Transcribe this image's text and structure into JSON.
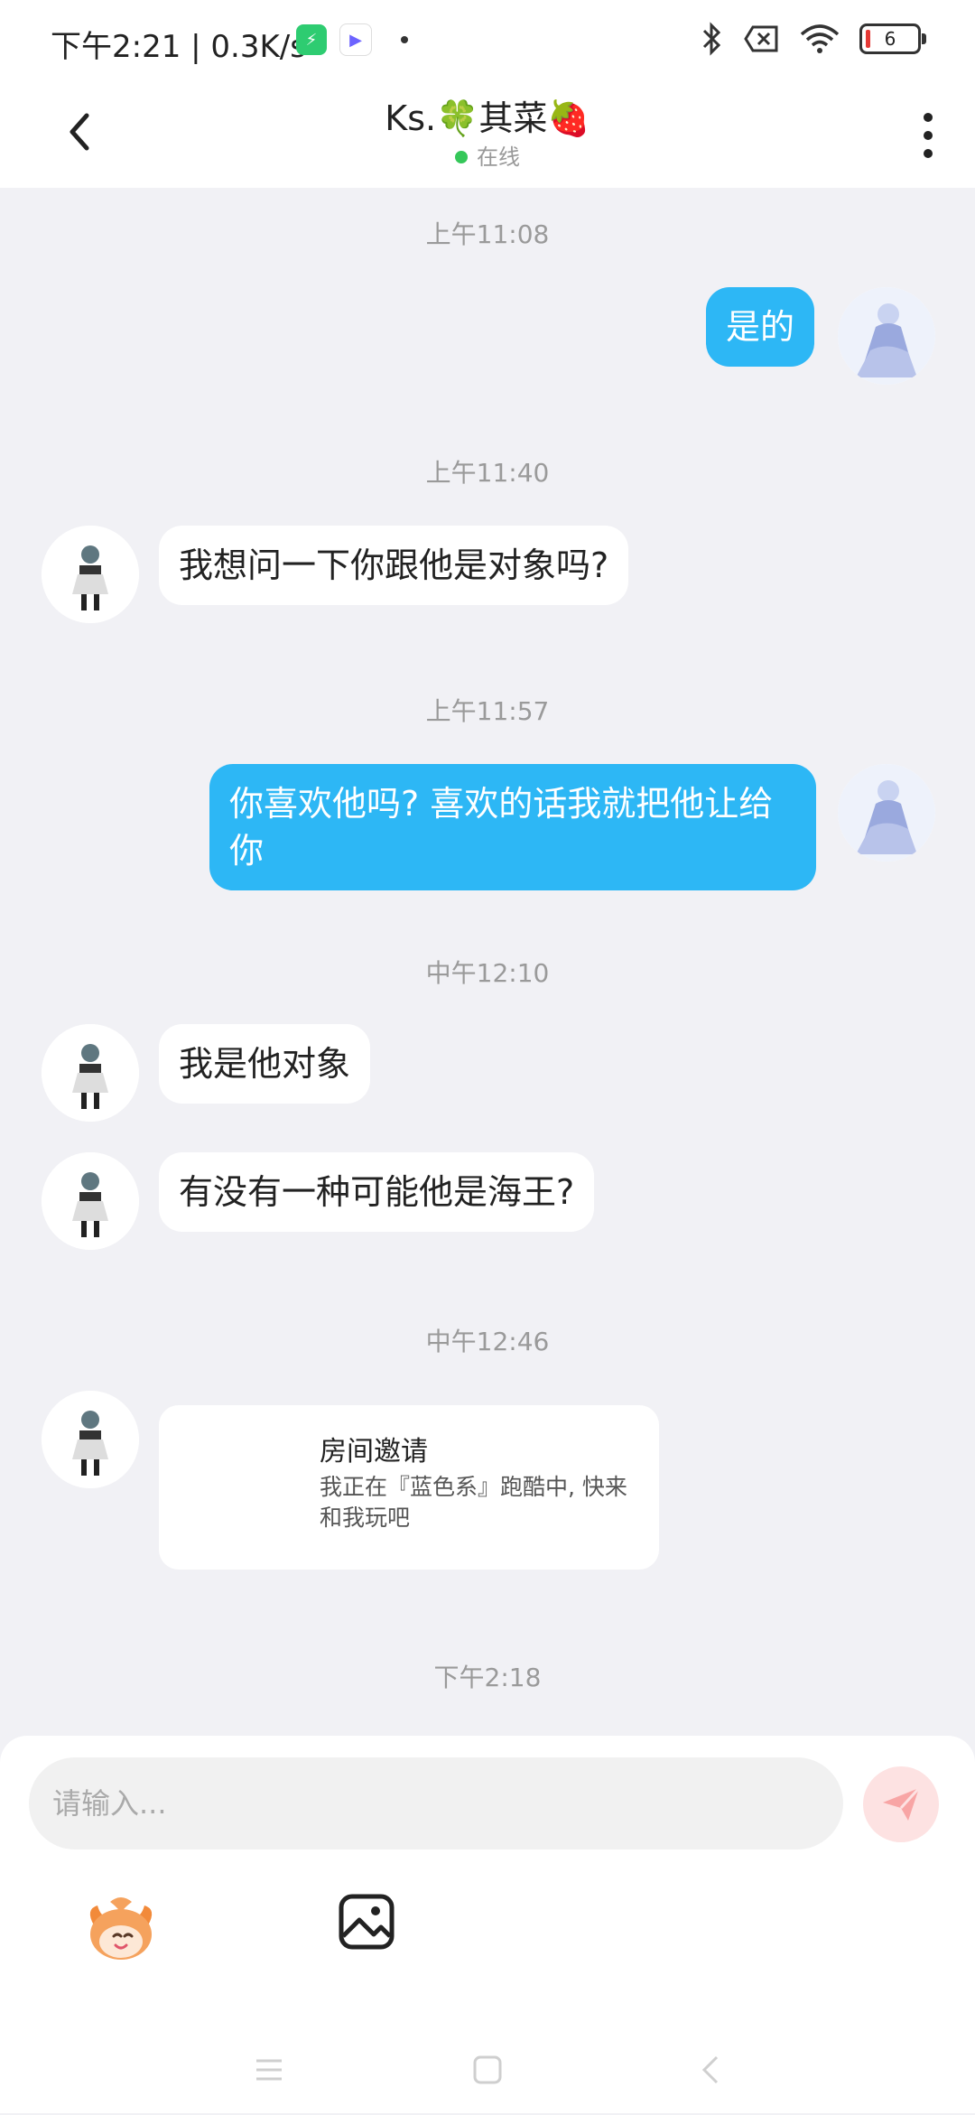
{
  "status_bar": {
    "time": "下午2:21 | 0.3K/s",
    "battery": "6"
  },
  "header": {
    "title": "Ks.🍀其菜🍓",
    "status": "在线"
  },
  "messages": [
    {
      "timestamp": "上午11:08"
    },
    {
      "from": "me",
      "text": "是的"
    },
    {
      "timestamp": "上午11:40"
    },
    {
      "from": "other",
      "text": "我想问一下你跟他是对象吗?"
    },
    {
      "timestamp": "上午11:57"
    },
    {
      "from": "me",
      "text": "你喜欢他吗? 喜欢的话我就把他让给你"
    },
    {
      "timestamp": "中午12:10"
    },
    {
      "from": "other",
      "text": "我是他对象"
    },
    {
      "from": "other",
      "text": "有没有一种可能他是海王?"
    },
    {
      "timestamp": "中午12:46"
    },
    {
      "from": "other",
      "type": "invite_card",
      "title": "房间邀请",
      "desc": "我正在『蓝色系』跑酷中, 快来和我玩吧"
    },
    {
      "timestamp": "下午2:18"
    }
  ],
  "composer": {
    "placeholder": "请输入..."
  },
  "colors": {
    "accent": "#2db7f5",
    "online": "#35c759",
    "send_bg": "#fde2e2",
    "send_icon": "#f8a5a5"
  },
  "icons": [
    "back-arrow-icon",
    "more-vertical-icon",
    "send-icon",
    "emoji-mascot-icon",
    "image-icon",
    "bluetooth-icon",
    "wifi-icon",
    "battery-icon"
  ]
}
